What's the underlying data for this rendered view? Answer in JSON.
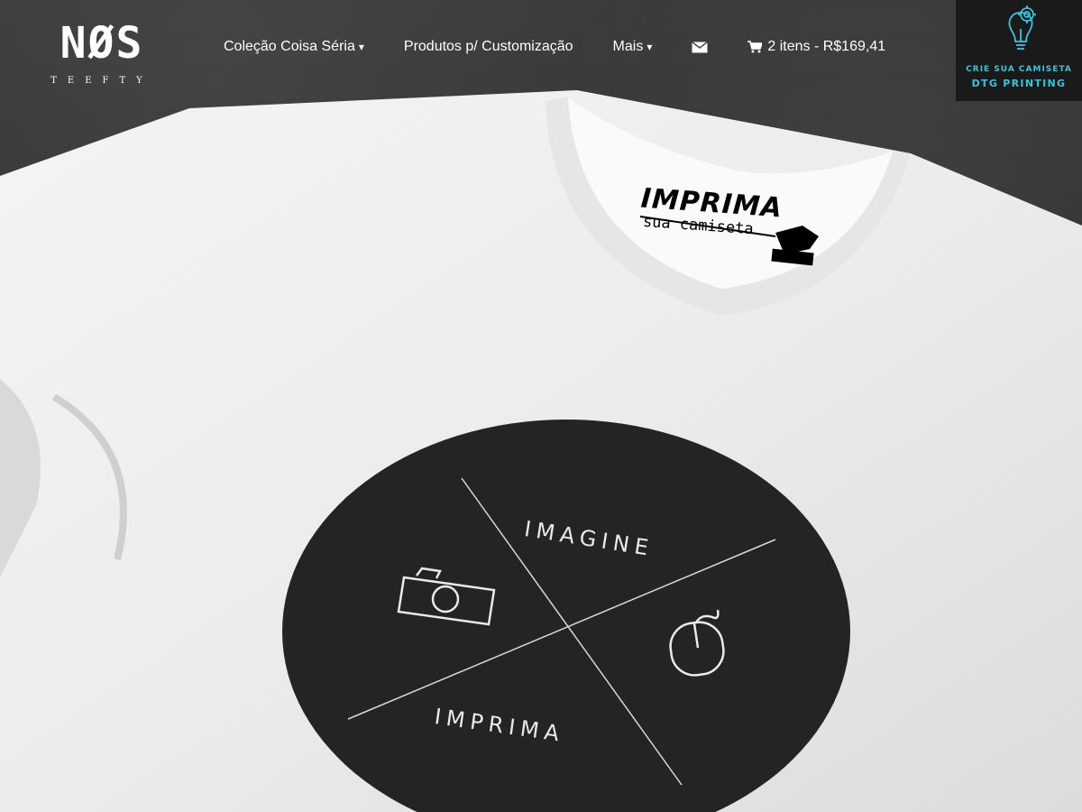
{
  "brand": {
    "logo": "NØS",
    "tagline": "TEEFTY"
  },
  "nav": {
    "items": [
      {
        "label": "Coleção Coisa Séria",
        "has_dropdown": true
      },
      {
        "label": "Produtos p/ Customização",
        "has_dropdown": false
      },
      {
        "label": "Mais",
        "has_dropdown": true
      }
    ],
    "caret": "▾",
    "contact_icon": "envelope-icon",
    "cart": {
      "icon": "shopping-cart-icon",
      "text": "2 itens - R$169,41"
    }
  },
  "promo": {
    "icon": "lightbulb-gear-icon",
    "line1": "CRIE SUA CAMISETA",
    "line2": "DTG PRINTING",
    "color": "#3bc3dd"
  },
  "hero": {
    "shirt_label_title": "IMPRIMA",
    "shirt_label_subtitle": "sua camiseta",
    "print_top": "IMAGINE",
    "print_bottom": "IMPRIMA",
    "print_icons": [
      "camera-icon",
      "mouse-icon"
    ]
  }
}
